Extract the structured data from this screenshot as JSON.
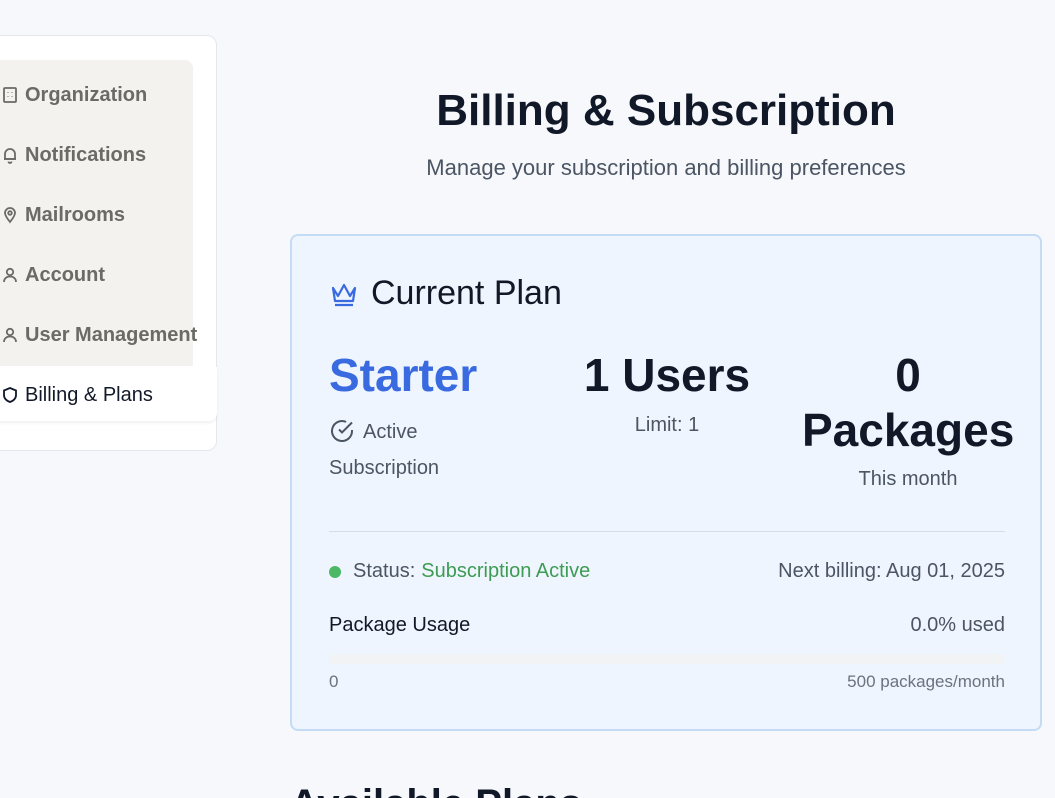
{
  "sidebar": {
    "items": [
      {
        "label": "Organization",
        "icon": "building-icon"
      },
      {
        "label": "Notifications",
        "icon": "bell-icon"
      },
      {
        "label": "Mailrooms",
        "icon": "map-pin-icon"
      },
      {
        "label": "Account",
        "icon": "user-icon"
      },
      {
        "label": "User Management",
        "icon": "users-icon"
      },
      {
        "label": "Billing & Plans",
        "icon": "shield-icon",
        "active": true
      }
    ]
  },
  "header": {
    "title": "Billing & Subscription",
    "subtitle": "Manage your subscription and billing preferences"
  },
  "current_plan": {
    "heading": "Current Plan",
    "icon": "crown-icon",
    "plan_name": "Starter",
    "plan_status_line1": "Active",
    "plan_status_line2": "Subscription",
    "users_value": "1 Users",
    "users_limit": "Limit: 1",
    "packages_value_line1": "0",
    "packages_value_line2": "Packages",
    "packages_sub": "This month",
    "status_label": "Status:",
    "status_value": "Subscription Active",
    "next_billing": "Next billing: Aug 01, 2025",
    "usage_label": "Package Usage",
    "usage_percent_text": "0.0% used",
    "usage_fraction": 0.0,
    "scale_min": "0",
    "scale_max": "500 packages/month"
  },
  "next_section_title": "Available Plans",
  "colors": {
    "accent": "#3a6ae0",
    "success": "#3d9b52",
    "card_bg": "#eef5fe"
  }
}
